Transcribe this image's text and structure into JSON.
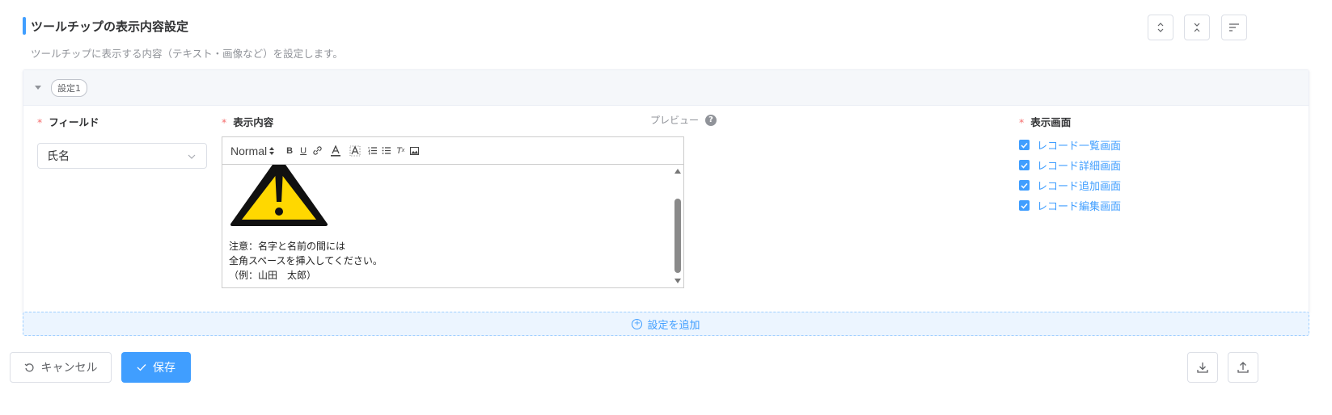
{
  "header": {
    "title": "ツールチップの表示内容設定",
    "description": "ツールチップに表示する内容（テキスト・画像など）を設定します。"
  },
  "colors": {
    "accent": "#409eff",
    "required": "#f56c6c",
    "warning_yellow": "#ffd800"
  },
  "header_buttons": [
    {
      "icon": "expand-all-icon"
    },
    {
      "icon": "collapse-all-icon"
    },
    {
      "icon": "sort-icon"
    }
  ],
  "setting": {
    "tag": "設定1",
    "field": {
      "label": "フィールド",
      "value": "氏名"
    },
    "content": {
      "label": "表示内容",
      "preview_label": "プレビュー",
      "format": "Normal",
      "lines": [
        "注意：名字と名前の間には",
        "全角スペースを挿入してください。",
        "（例：山田　太郎）"
      ]
    },
    "screens": {
      "label": "表示画面",
      "items": [
        {
          "label": "レコード一覧画面",
          "checked": true
        },
        {
          "label": "レコード詳細画面",
          "checked": true
        },
        {
          "label": "レコード追加画面",
          "checked": true
        },
        {
          "label": "レコード編集画面",
          "checked": true
        }
      ]
    }
  },
  "add_button": "設定を追加",
  "footer": {
    "cancel": "キャンセル",
    "save": "保存"
  }
}
